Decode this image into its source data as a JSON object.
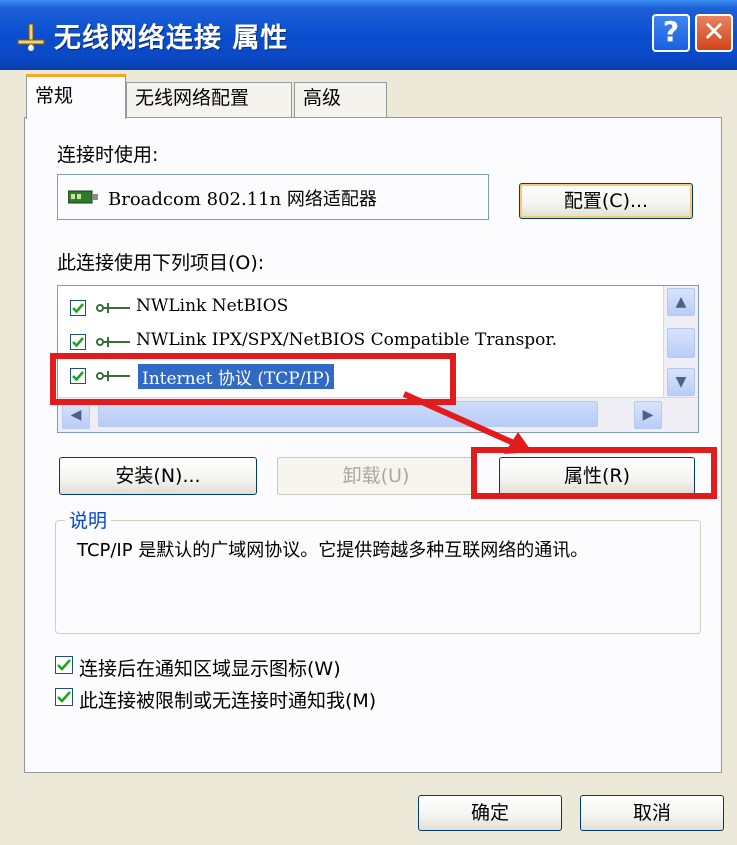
{
  "window": {
    "title": "无线网络连接 属性",
    "help_glyph": "?",
    "close_glyph": "✕",
    "title_icon": "network-connection-icon"
  },
  "tabs": [
    {
      "label": "常规",
      "active": true
    },
    {
      "label": "无线网络配置",
      "active": false
    },
    {
      "label": "高级",
      "active": false
    }
  ],
  "general": {
    "connect_using_label": "连接时使用:",
    "adapter_name": "Broadcom 802.11n 网络适配器",
    "adapter_icon": "network-adapter-icon",
    "configure_button": "配置(C)...",
    "items_label": "此连接使用下列项目(O):",
    "items": [
      {
        "label": "NWLink NetBIOS",
        "checked": true,
        "selected": false,
        "icon": "protocol-icon"
      },
      {
        "label": "NWLink IPX/SPX/NetBIOS Compatible Transpor.",
        "checked": true,
        "selected": false,
        "icon": "protocol-icon"
      },
      {
        "label": "Internet 协议 (TCP/IP)",
        "checked": true,
        "selected": true,
        "icon": "protocol-icon"
      }
    ],
    "install_button": "安装(N)...",
    "uninstall_button": "卸载(U)",
    "properties_button": "属性(R)",
    "description_title": "说明",
    "description_text": "TCP/IP 是默认的广域网协议。它提供跨越多种互联网络的通讯。",
    "show_icon_label": "连接后在通知区域显示图标(W)",
    "show_icon_checked": true,
    "notify_label": "此连接被限制或无连接时通知我(M)",
    "notify_checked": true
  },
  "footer": {
    "ok_button": "确定",
    "cancel_button": "取消"
  },
  "annotations": {
    "highlight_color": "#e21c1c"
  },
  "colors": {
    "title_bar": "#0a4fd0",
    "selection": "#316ac5",
    "dialog_bg": "#ece9d8",
    "panel_bg": "#fcfcfe",
    "group_title": "#0046d5"
  }
}
